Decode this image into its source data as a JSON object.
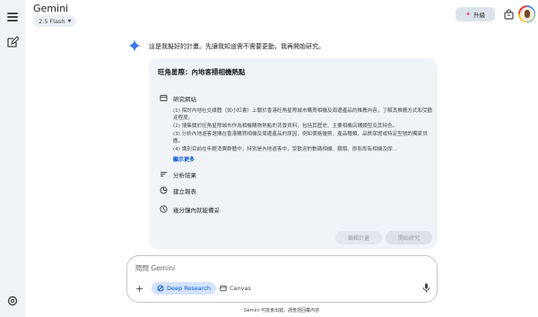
{
  "app": {
    "title": "Gemini",
    "model": "2.5 Flash"
  },
  "header": {
    "upgrade_label": "升級"
  },
  "intro": "這是我擬好的計畫。先讓我知道需不需要更動，我再開始研究。",
  "plan": {
    "title": "旺角星際：內地客掃相機熱點",
    "step1_label": "研究網站",
    "details": [
      "(1) 探討內地社交媒體（如小紅書）上關於香港旺角星際城市購買相機及周邊產品的推薦內容，了解其推薦方式和受歡迎程度。",
      "(2) 搜集關於旺角星際城市作為相機購物熱點的背景資料，包括其歷史、主要相機店鋪類型及其特色。",
      "(3) 分析內地遊客選擇在香港購買相機及周邊產品的原因，例如價格優勢、產品種類、品質保證或特定型號的獨家供應。",
      "(4) 識別目前在年輕消費群體中，特別是內地遊客中，受歡迎的數碼相機、鏡頭、即影即有相機及即..."
    ],
    "show_more": "顯示更多",
    "step2_label": "分析結果",
    "step3_label": "建立報表",
    "eta": "幾分鐘內就能備妥",
    "edit_label": "編輯計畫",
    "start_label": "開始研究"
  },
  "input": {
    "placeholder": "問問 Gemini",
    "deep_research_label": "Deep Research",
    "canvas_label": "Canvas"
  },
  "footer": "Gemini 可能會出錯，請查證回覆內容",
  "colors": {
    "accent": "#0b57d0",
    "rail": "#f0f4f9",
    "chip": "#d3e3fd"
  },
  "icons": [
    "menu-icon",
    "new-chat-icon",
    "settings-icon",
    "sparkle-icon",
    "bag-icon",
    "browser-icon",
    "list-icon",
    "report-icon",
    "clock-icon",
    "plus-icon",
    "mic-icon",
    "telescope-icon",
    "canvas-icon"
  ]
}
